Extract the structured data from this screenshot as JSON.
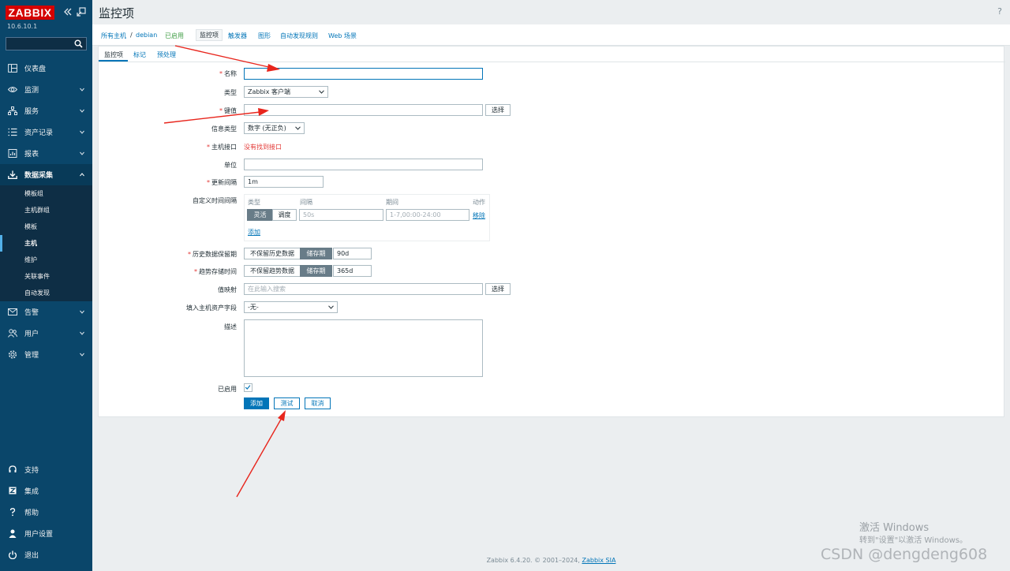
{
  "sidebar": {
    "logo": "ZABBIX",
    "version": "10.6.10.1",
    "search_placeholder": "",
    "menu": [
      {
        "label": "仪表盘"
      },
      {
        "label": "监测"
      },
      {
        "label": "服务"
      },
      {
        "label": "资产记录"
      },
      {
        "label": "报表"
      },
      {
        "label": "数据采集"
      },
      {
        "label": "告警"
      },
      {
        "label": "用户"
      },
      {
        "label": "管理"
      }
    ],
    "submenu": [
      "模板组",
      "主机群组",
      "模板",
      "主机",
      "维护",
      "关联事件",
      "自动发现"
    ],
    "bottom": [
      {
        "label": "支持"
      },
      {
        "label": "集成"
      },
      {
        "label": "帮助"
      },
      {
        "label": "用户设置"
      },
      {
        "label": "退出"
      }
    ]
  },
  "header": {
    "title": "监控项",
    "help": "?"
  },
  "nav": {
    "all_hosts": "所有主机",
    "sep": "/",
    "host": "debian",
    "status": "已启用",
    "tabs": [
      "监控项",
      "触发器",
      "图形",
      "自动发现规则",
      "Web 场景"
    ]
  },
  "form_tabs": [
    "监控项",
    "标记",
    "预处理"
  ],
  "form": {
    "name_label": "名称",
    "name_value": "",
    "type_label": "类型",
    "type_value": "Zabbix 客户端",
    "key_label": "键值",
    "key_value": "",
    "select_btn": "选择",
    "info_type_label": "信息类型",
    "info_type_value": "数字 (无正负)",
    "host_iface_label": "主机接口",
    "host_iface_error": "没有找到接口",
    "units_label": "单位",
    "units_value": "",
    "interval_label": "更新间隔",
    "interval_value": "1m",
    "custom_intervals_label": "自定义时间间隔",
    "ci_col_type": "类型",
    "ci_col_interval": "间隔",
    "ci_col_period": "期间",
    "ci_col_action": "动作",
    "ci_flexible": "灵活",
    "ci_scheduling": "调度",
    "ci_interval_ph": "50s",
    "ci_period_ph": "1-7,00:00-24:00",
    "ci_remove": "移除",
    "ci_add": "添加",
    "history_label": "历史数据保留期",
    "history_no": "不保留历史数据",
    "history_store": "储存期",
    "history_value": "90d",
    "trends_label": "趋势存储时间",
    "trends_no": "不保留趋势数据",
    "trends_store": "储存期",
    "trends_value": "365d",
    "valuemap_label": "值映射",
    "valuemap_ph": "在此输入搜索",
    "inventory_label": "填入主机资产字段",
    "inventory_value": "-无-",
    "desc_label": "描述",
    "enabled_label": "已启用",
    "btn_add": "添加",
    "btn_test": "测试",
    "btn_cancel": "取消"
  },
  "footer": {
    "text": "Zabbix 6.4.20. © 2001–2024,",
    "link": "Zabbix SIA"
  },
  "watermark": {
    "line1": "激活 Windows",
    "line2": "转到\"设置\"以激活 Windows。",
    "line3": "CSDN @dengdeng608"
  },
  "colors": {
    "sidebar_bg": "#0a466a",
    "accent": "#0275b8",
    "logo_red": "#d40000",
    "annotation_red": "#e8261d"
  }
}
